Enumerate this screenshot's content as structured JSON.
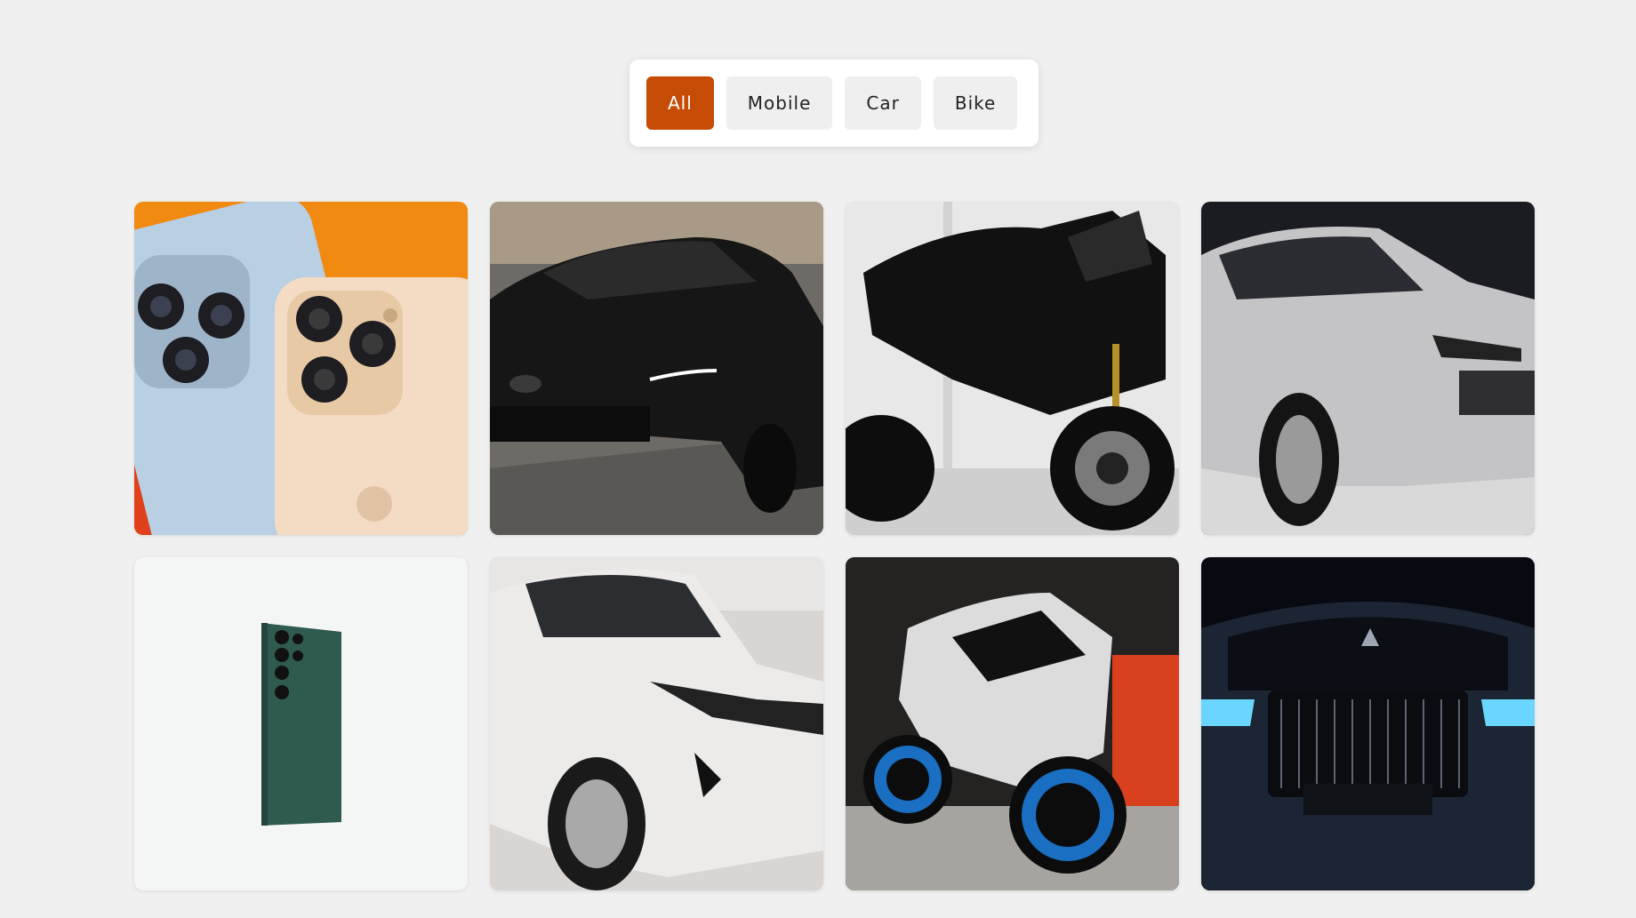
{
  "filters": {
    "all": "All",
    "mobile": "Mobile",
    "car": "Car",
    "bike": "Bike",
    "active": "All"
  },
  "colors": {
    "accent": "#c64b04",
    "page_background": "#f0f0f0"
  },
  "gallery": {
    "items": [
      {
        "category": "mobile",
        "subject": "iPhone pair on orange"
      },
      {
        "category": "car",
        "subject": "black sedan"
      },
      {
        "category": "bike",
        "subject": "black sport bike"
      },
      {
        "category": "car",
        "subject": "silver SUV"
      },
      {
        "category": "mobile",
        "subject": "green smartphone"
      },
      {
        "category": "car",
        "subject": "white SUV"
      },
      {
        "category": "bike",
        "subject": "blue sport bike"
      },
      {
        "category": "car",
        "subject": "dark luxury car"
      }
    ]
  }
}
